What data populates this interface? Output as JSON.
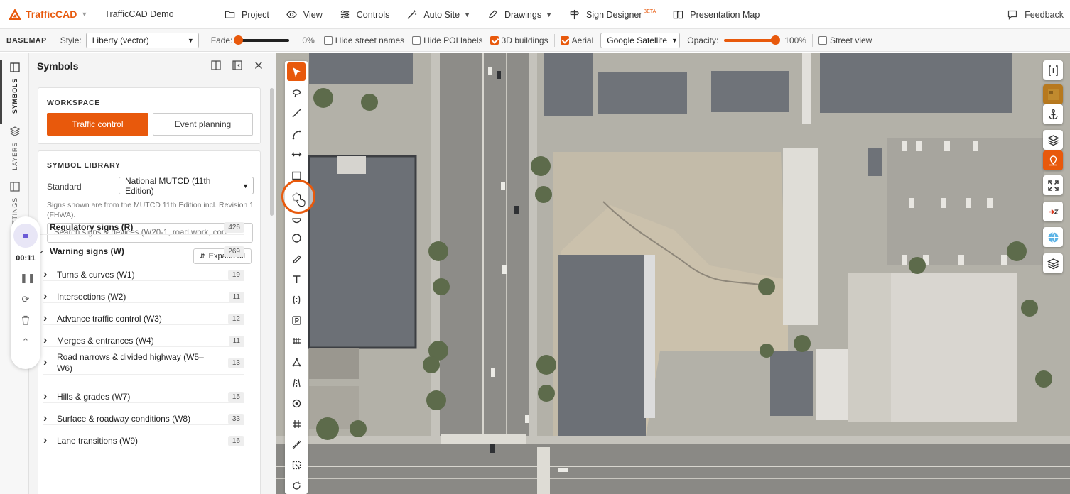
{
  "app": {
    "brand": "TrafficCAD",
    "project": "TrafficCAD Demo"
  },
  "menu": [
    {
      "label": "Project",
      "icon": "folder-icon"
    },
    {
      "label": "View",
      "icon": "eye-icon"
    },
    {
      "label": "Controls",
      "icon": "sliders-icon"
    },
    {
      "label": "Auto Site",
      "icon": "wand-icon"
    },
    {
      "label": "Drawings",
      "icon": "pen-icon"
    },
    {
      "label": "Sign Designer",
      "icon": "signpost-icon",
      "badge": "BETA"
    },
    {
      "label": "Presentation Map",
      "icon": "book-map-icon"
    }
  ],
  "feedback": "Feedback",
  "basemap": {
    "label": "BASEMAP",
    "style_label": "Style:",
    "style_value": "Liberty (vector)",
    "fade_label": "Fade:",
    "fade_value": "0%",
    "fade_level": 0,
    "hide_street_names": "Hide street names",
    "hide_poi": "Hide POI labels",
    "buildings_3d": "3D buildings",
    "aerial": "Aerial",
    "aerial_source": "Google Satellite",
    "opacity_label": "Opacity:",
    "opacity_value": "100%",
    "opacity_level": 1.0,
    "street_view": "Street view",
    "checks": {
      "hide_street_names": false,
      "hide_poi": false,
      "buildings_3d": true,
      "aerial": true,
      "street_view": false
    }
  },
  "rail": {
    "symbols": "SYMBOLS",
    "layers": "LAYERS",
    "settings": "SETTINGS"
  },
  "recorder": {
    "time": "00:11"
  },
  "panel": {
    "title": "Symbols",
    "workspace": {
      "title": "WORKSPACE",
      "options": [
        "Traffic control",
        "Event planning"
      ],
      "selected": "Traffic control"
    },
    "library": {
      "title": "SYMBOL LIBRARY",
      "standard_label": "Standard",
      "standard_value": "National MUTCD (11th Edition)",
      "note": "Signs shown are from the MUTCD 11th Edition incl. Revision 1 (FHWA).",
      "search_placeholder": "Search signs & devices (W20-1, road work, cone...",
      "expand_all": "Expand all"
    },
    "categories": [
      {
        "label": "Regulatory signs (R)",
        "count": "426",
        "expanded": false,
        "level": 0
      },
      {
        "label": "Warning signs (W)",
        "count": "269",
        "expanded": true,
        "level": 0
      },
      {
        "label": "Turns & curves (W1)",
        "count": "19",
        "level": 1
      },
      {
        "label": "Intersections (W2)",
        "count": "11",
        "level": 1
      },
      {
        "label": "Advance traffic control (W3)",
        "count": "12",
        "level": 1
      },
      {
        "label": "Merges & entrances (W4)",
        "count": "11",
        "level": 1
      },
      {
        "label": "Road narrows & divided highway (W5–W6)",
        "count": "13",
        "level": 1
      },
      {
        "label": "Hills & grades (W7)",
        "count": "15",
        "level": 1
      },
      {
        "label": "Surface & roadway conditions (W8)",
        "count": "33",
        "level": 1
      },
      {
        "label": "Lane transitions (W9)",
        "count": "16",
        "level": 1
      }
    ]
  },
  "tools": [
    "select-tool",
    "lasso-tool",
    "line-tool",
    "curve-tool",
    "dimension-tool",
    "rectangle-tool",
    "polygon-tool",
    "half-circle-tool",
    "circle-tool",
    "pencil-tool",
    "text-tool",
    "bracket-tool",
    "parking-tool",
    "crosswalk-tool",
    "node-tool",
    "lane-tool",
    "target-tool",
    "hash-tool",
    "ruler-tool",
    "area-select-tool",
    "rotate-tool"
  ],
  "colors": {
    "accent": "#e8590c",
    "map_background": "#b9b6ad"
  }
}
